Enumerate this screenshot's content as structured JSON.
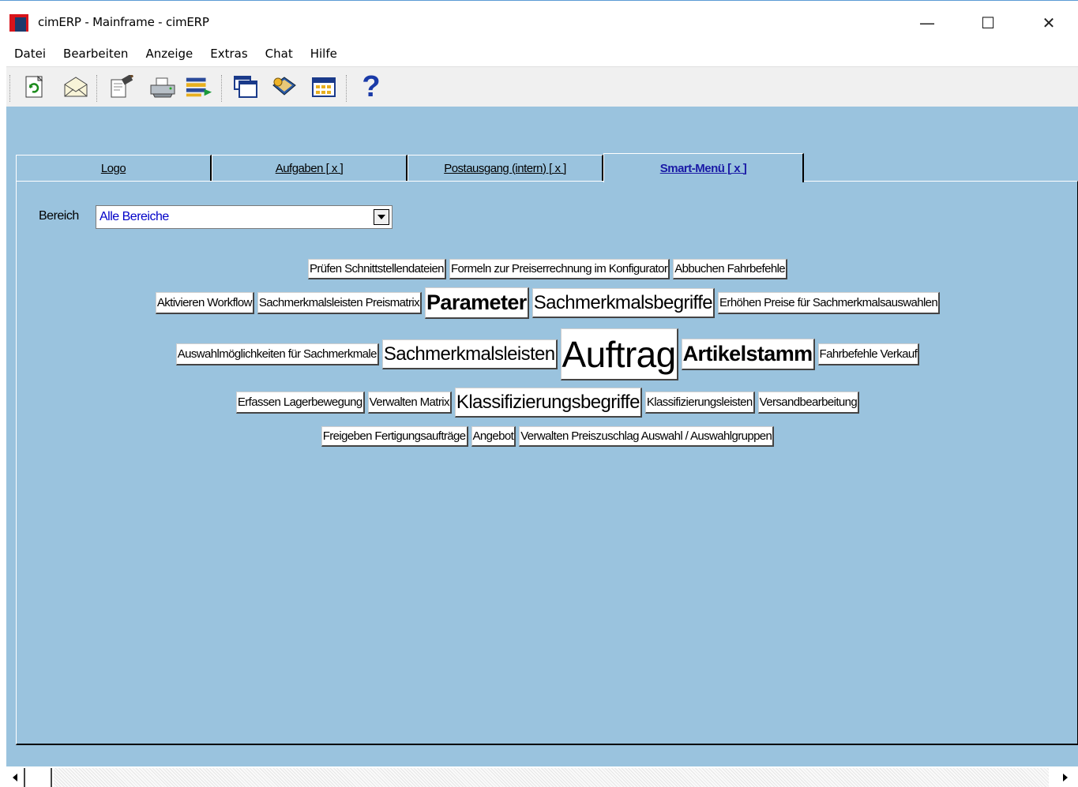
{
  "window": {
    "title": "cimERP - Mainframe - cimERP",
    "controls": {
      "minimize": "—",
      "maximize": "☐",
      "close": "✕"
    }
  },
  "menubar": {
    "items": [
      {
        "label": "Datei"
      },
      {
        "label": "Bearbeiten"
      },
      {
        "label": "Anzeige"
      },
      {
        "label": "Extras"
      },
      {
        "label": "Chat"
      },
      {
        "label": "Hilfe"
      }
    ]
  },
  "toolbar": {
    "buttons": [
      {
        "icon": "refresh-icon"
      },
      {
        "icon": "mail-icon"
      },
      {
        "icon": "edit-document-icon"
      },
      {
        "icon": "printer-icon"
      },
      {
        "icon": "list-export-icon"
      },
      {
        "icon": "windows-cascade-icon"
      },
      {
        "icon": "book-icon"
      },
      {
        "icon": "calendar-icon"
      },
      {
        "icon": "help-icon"
      }
    ],
    "help_glyph": "?"
  },
  "tabs": [
    {
      "label": "Logo",
      "active": false
    },
    {
      "label": "Aufgaben [ x ]",
      "active": false
    },
    {
      "label": "Postausgang (intern) [ x ]",
      "active": false
    },
    {
      "label": "Smart-Menü [ x ]",
      "active": true
    }
  ],
  "bereich": {
    "label": "Bereich",
    "value": "Alle Bereiche"
  },
  "smart_menu": {
    "rows": [
      [
        "Prüfen Schnittstellendateien",
        "Formeln zur Preiserrechnung im Konfigurator",
        "Abbuchen Fahrbefehle"
      ],
      [
        "Aktivieren Workflow",
        "Sachmerkmalsleisten Preismatrix",
        "Parameter",
        "Sachmerkmalsbegriffe",
        "Erhöhen Preise für Sachmerkmalsauswahlen"
      ],
      [
        "Auswahlmöglichkeiten für Sachmerkmale",
        "Sachmerkmalsleisten",
        "Auftrag",
        "Artikelstamm",
        "Fahrbefehle Verkauf"
      ],
      [
        "Erfassen Lagerbewegung",
        "Verwalten Matrix",
        "Klassifizierungsbegriffe",
        "Klassifizierungsleisten",
        "Versandbearbeitung"
      ],
      [
        "Freigeben Fertigungsaufträge",
        "Angebot",
        "Verwalten Preiszuschlag Auswahl / Auswahlgruppen"
      ]
    ]
  },
  "colors": {
    "workspace": "#9ac3de",
    "active_tab_text": "#1a1aa6",
    "select_value": "#0000c8",
    "app_icon_red": "#d8141a",
    "app_icon_blue": "#1c3a6c"
  }
}
